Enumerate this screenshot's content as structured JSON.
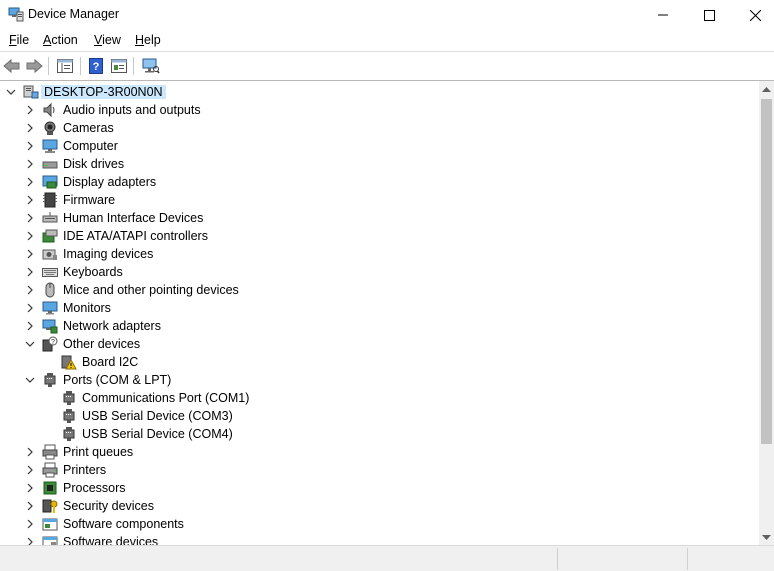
{
  "window": {
    "title": "Device Manager"
  },
  "menu": [
    {
      "label": "File",
      "accel": "F",
      "rest": "ile"
    },
    {
      "label": "Action",
      "accel": "A",
      "rest": "ction"
    },
    {
      "label": "View",
      "accel": "V",
      "rest": "iew"
    },
    {
      "label": "Help",
      "accel": "H",
      "rest": "elp"
    }
  ],
  "toolbar": {
    "buttons": [
      "back-arrow-icon",
      "forward-arrow-icon",
      "show-hide-console-tree-icon",
      "help-icon",
      "properties-icon",
      "scan-hardware-icon"
    ]
  },
  "tree": {
    "root": "DESKTOP-3R00N0N",
    "items": [
      {
        "label": "Audio inputs and outputs",
        "icon": "audio-icon",
        "state": "collapsed"
      },
      {
        "label": "Cameras",
        "icon": "camera-icon",
        "state": "collapsed"
      },
      {
        "label": "Computer",
        "icon": "computer-icon",
        "state": "collapsed"
      },
      {
        "label": "Disk drives",
        "icon": "disk-drive-icon",
        "state": "collapsed"
      },
      {
        "label": "Display adapters",
        "icon": "display-adapter-icon",
        "state": "collapsed"
      },
      {
        "label": "Firmware",
        "icon": "firmware-icon",
        "state": "collapsed"
      },
      {
        "label": "Human Interface Devices",
        "icon": "hid-icon",
        "state": "collapsed"
      },
      {
        "label": "IDE ATA/ATAPI controllers",
        "icon": "ide-controller-icon",
        "state": "collapsed"
      },
      {
        "label": "Imaging devices",
        "icon": "imaging-icon",
        "state": "collapsed"
      },
      {
        "label": "Keyboards",
        "icon": "keyboard-icon",
        "state": "collapsed"
      },
      {
        "label": "Mice and other pointing devices",
        "icon": "mouse-icon",
        "state": "collapsed"
      },
      {
        "label": "Monitors",
        "icon": "monitor-icon",
        "state": "collapsed"
      },
      {
        "label": "Network adapters",
        "icon": "network-adapter-icon",
        "state": "collapsed"
      },
      {
        "label": "Other devices",
        "icon": "other-devices-icon",
        "state": "expanded"
      },
      {
        "label": "Board I2C",
        "icon": "warning-device-icon",
        "state": "child"
      },
      {
        "label": "Ports (COM & LPT)",
        "icon": "port-icon",
        "state": "expanded"
      },
      {
        "label": "Communications Port (COM1)",
        "icon": "port-icon",
        "state": "child"
      },
      {
        "label": "USB Serial Device (COM3)",
        "icon": "port-icon",
        "state": "child"
      },
      {
        "label": "USB Serial Device (COM4)",
        "icon": "port-icon",
        "state": "child"
      },
      {
        "label": "Print queues",
        "icon": "print-queue-icon",
        "state": "collapsed"
      },
      {
        "label": "Printers",
        "icon": "printer-icon",
        "state": "collapsed"
      },
      {
        "label": "Processors",
        "icon": "processor-icon",
        "state": "collapsed"
      },
      {
        "label": "Security devices",
        "icon": "security-device-icon",
        "state": "collapsed"
      },
      {
        "label": "Software components",
        "icon": "software-component-icon",
        "state": "collapsed"
      },
      {
        "label": "Software devices",
        "icon": "software-device-icon",
        "state": "collapsed"
      }
    ]
  },
  "colors": {
    "selection": "#cce8ff",
    "accent": "#0078d7",
    "warning": "#f5c400"
  }
}
